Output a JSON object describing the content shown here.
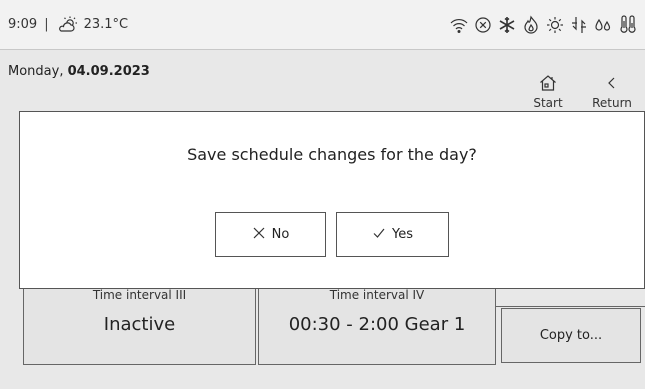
{
  "status_bar": {
    "time": "9:09",
    "separator": "|",
    "temperature": "23.1°C",
    "weather_icon": "partly-sunny-icon",
    "icons": [
      "wifi-icon",
      "cancel-circle-icon",
      "snowflake-icon",
      "flame-icon",
      "sun-dust-icon",
      "air-flow-icon",
      "water-drops-icon",
      "thermometer-icon"
    ]
  },
  "header": {
    "date_prefix": "Monday,",
    "date_value": "04.09.2023",
    "start_label": "Start",
    "return_label": "Return"
  },
  "tiles": {
    "interval3": {
      "title": "Time interval III",
      "value": "Inactive"
    },
    "interval4": {
      "title": "Time interval IV",
      "value": "00:30 - 2:00 Gear 1"
    },
    "copy_label": "Copy to..."
  },
  "dialog": {
    "message": "Save schedule changes for the day?",
    "no_label": "No",
    "yes_label": "Yes"
  }
}
